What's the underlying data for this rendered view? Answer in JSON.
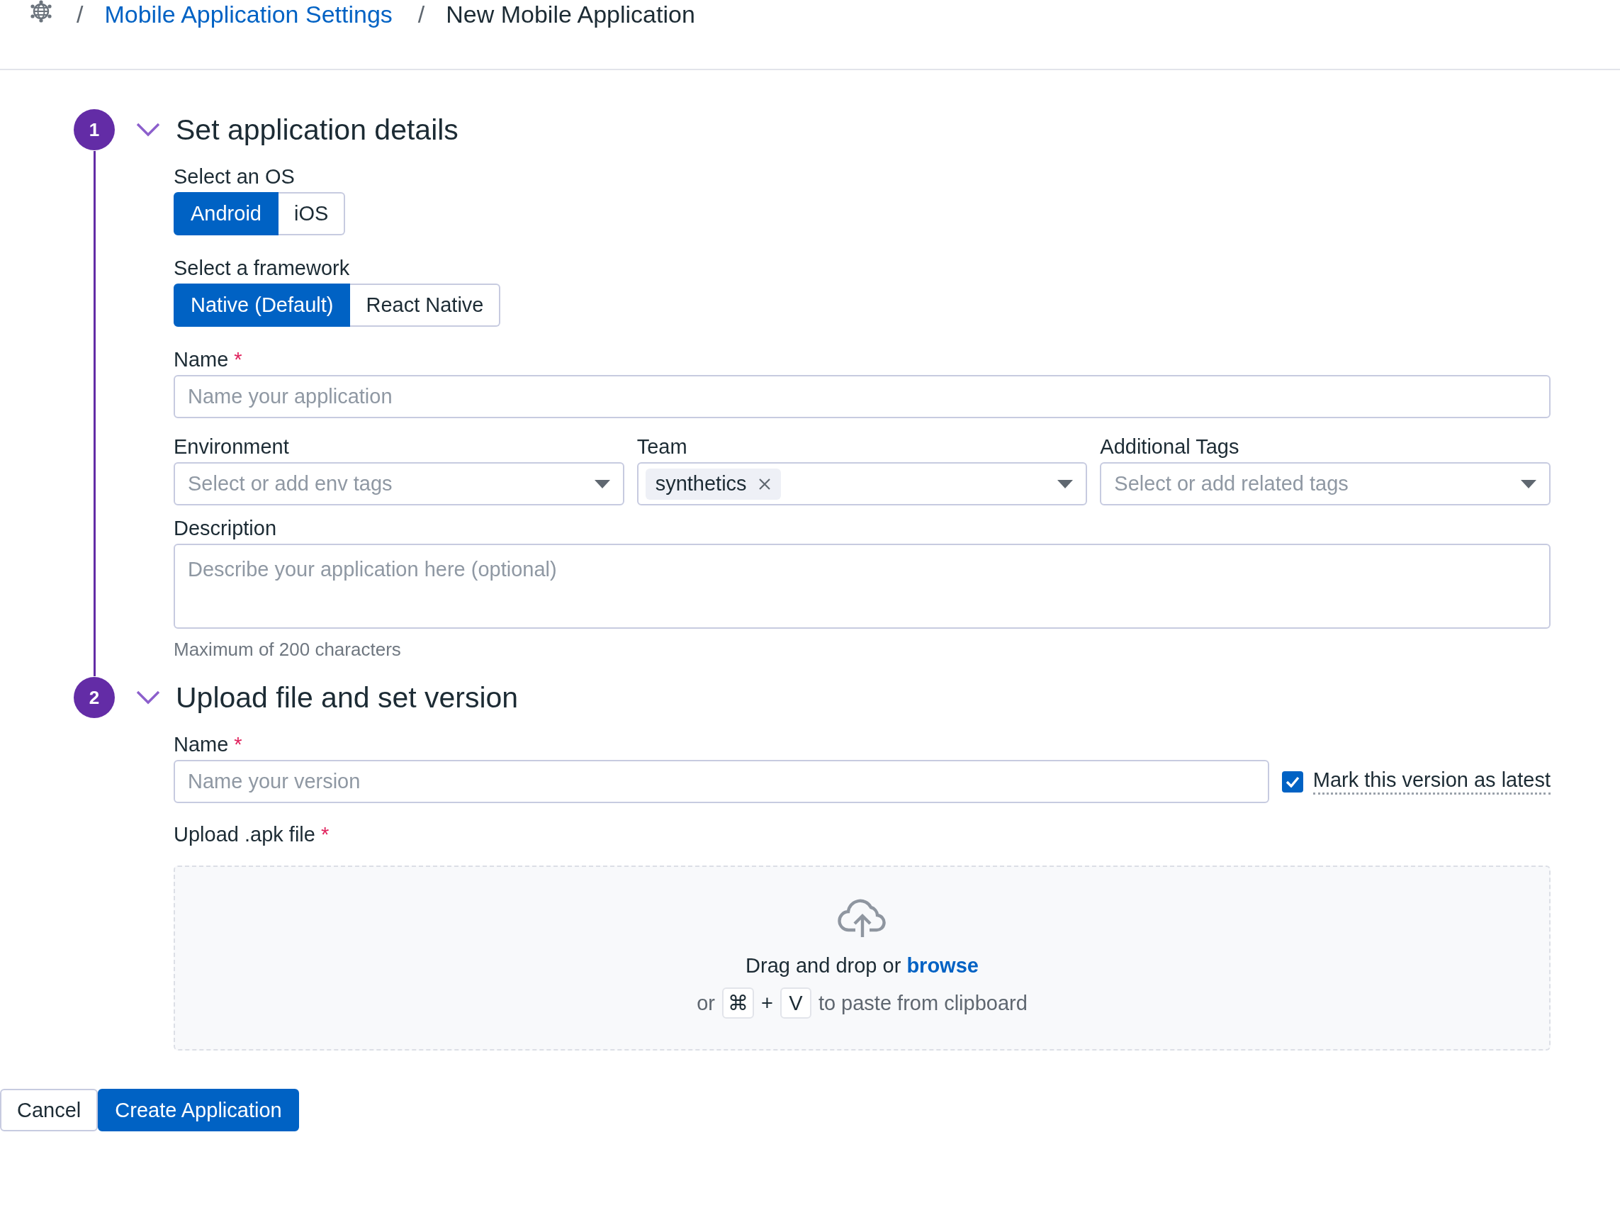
{
  "breadcrumb": [
    {
      "kind": "separator",
      "text": "/"
    },
    {
      "kind": "link",
      "text": "Mobile Application Settings"
    },
    {
      "kind": "separator",
      "text": "/"
    },
    {
      "kind": "current",
      "text": "New Mobile Application"
    }
  ],
  "steps": [
    {
      "number": "1",
      "title": "Set application details",
      "expanded": true,
      "fields": [
        {
          "kind": "segmented",
          "label": "Select an OS",
          "options": [
            {
              "label": "Android",
              "selected": true
            },
            {
              "label": "iOS",
              "selected": false
            }
          ]
        },
        {
          "kind": "segmented",
          "label": "Select a framework",
          "options": [
            {
              "label": "Native (Default)",
              "selected": true
            },
            {
              "label": "React Native",
              "selected": false
            }
          ]
        },
        {
          "kind": "text",
          "label": "Name",
          "required_mark": "*",
          "placeholder": "Name your application"
        },
        {
          "kind": "selects",
          "selects": [
            {
              "label": "Environment",
              "placeholder": "Select or add env tags"
            },
            {
              "label": "Team",
              "tags": [
                "synthetics"
              ]
            },
            {
              "label": "Additional Tags",
              "placeholder": "Select or add related tags"
            }
          ]
        },
        {
          "kind": "textarea",
          "label": "Description",
          "placeholder": "Describe your application here (optional)",
          "help": "Maximum of 200 characters"
        }
      ]
    },
    {
      "number": "2",
      "title": "Upload file and set version",
      "expanded": true,
      "fields": [
        {
          "kind": "text",
          "label": "Name",
          "required_mark": "*",
          "placeholder": "Name your version",
          "checkbox": {
            "label": "Mark this version as latest",
            "checked": true
          }
        },
        {
          "kind": "upload",
          "label": "Upload .apk file",
          "required_mark": "*",
          "text": "Drag and drop or",
          "link": "browse",
          "prefix": "or",
          "keys": [
            "⌘",
            "V"
          ],
          "joiner": "+",
          "suffix": "to paste from clipboard"
        }
      ]
    }
  ],
  "actions": [
    {
      "kind": "secondary",
      "label": "Cancel"
    },
    {
      "kind": "primary",
      "label": "Create Application"
    }
  ]
}
